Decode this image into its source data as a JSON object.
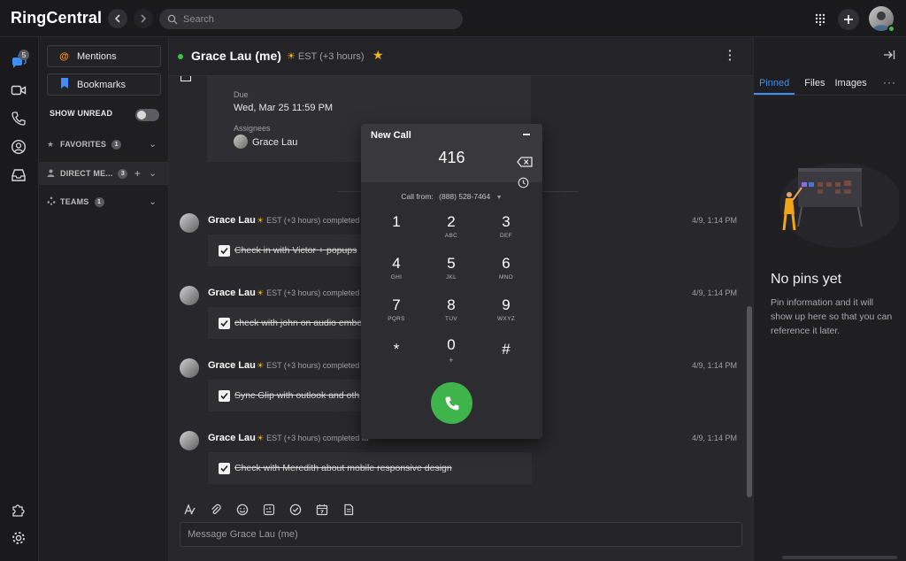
{
  "app": {
    "brand": "RingCentral"
  },
  "topbar": {
    "search_placeholder": "Search"
  },
  "rail": {
    "messages_badge": "5"
  },
  "side": {
    "mentions": "Mentions",
    "bookmarks": "Bookmarks",
    "show_unread": "SHOW UNREAD",
    "sections": [
      {
        "label": "FAVORITES",
        "count": "1"
      },
      {
        "label": "DIRECT ME...",
        "count": "3"
      },
      {
        "label": "TEAMS",
        "count": "1"
      }
    ]
  },
  "conversation": {
    "title": "Grace Lau (me)",
    "timezone": "EST (+3 hours)",
    "task": {
      "due_label": "Due",
      "due_value": "Wed, Mar 25 11:59 PM",
      "assignees_label": "Assignees",
      "assignee": "Grace Lau"
    },
    "posts": [
      {
        "name": "Grace Lau",
        "meta": "EST (+3 hours)  completed t",
        "time": "4/9, 1:14 PM",
        "task": "Check in with Victor + popups"
      },
      {
        "name": "Grace Lau",
        "meta": "EST (+3 hours)  completed t",
        "time": "4/9, 1:14 PM",
        "task": "check with john on audio embe"
      },
      {
        "name": "Grace Lau",
        "meta": "EST (+3 hours)  completed t",
        "time": "4/9, 1:14 PM",
        "task": "Sync Glip with outlook and oth"
      },
      {
        "name": "Grace Lau",
        "meta": "EST (+3 hours)  completed ta",
        "time": "4/9, 1:14 PM",
        "task": "Check with Meredith about mobile responsive design"
      }
    ],
    "composer_placeholder": "Message Grace Lau (me)"
  },
  "right_panel": {
    "tabs": [
      "Pinned",
      "Files",
      "Images"
    ],
    "more": "···",
    "empty_title": "No pins yet",
    "empty_desc": "Pin information and it will show up here so that you can reference it later."
  },
  "dialer": {
    "title": "New Call",
    "number": "416",
    "call_from_label": "Call from:",
    "call_from_number": "(888) 528-7464",
    "keys": [
      {
        "digit": "1",
        "letters": ""
      },
      {
        "digit": "2",
        "letters": "ABC"
      },
      {
        "digit": "3",
        "letters": "DEF"
      },
      {
        "digit": "4",
        "letters": "GHI"
      },
      {
        "digit": "5",
        "letters": "JKL"
      },
      {
        "digit": "6",
        "letters": "MNO"
      },
      {
        "digit": "7",
        "letters": "PQRS"
      },
      {
        "digit": "8",
        "letters": "TUV"
      },
      {
        "digit": "9",
        "letters": "WXYZ"
      },
      {
        "digit": "*",
        "letters": ""
      },
      {
        "digit": "0",
        "letters": "+"
      },
      {
        "digit": "#",
        "letters": ""
      }
    ]
  },
  "colors": {
    "accent": "#3f8ef5",
    "call_green": "#3fb44a",
    "presence": "#3ec24a",
    "star": "#f2b51b"
  }
}
